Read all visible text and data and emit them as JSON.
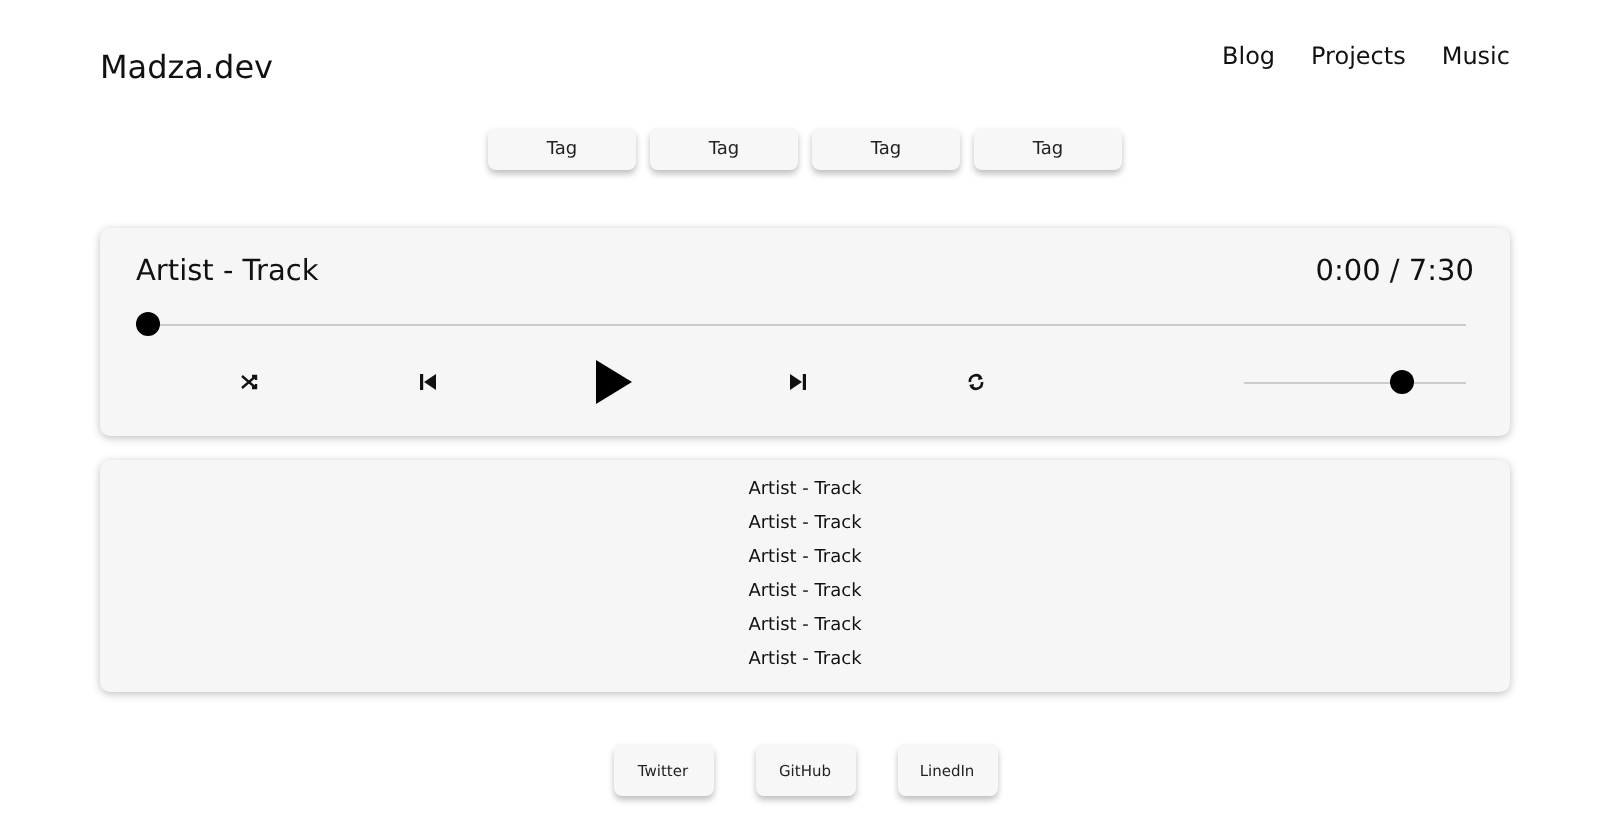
{
  "site": {
    "logo": "Madza.dev"
  },
  "nav": [
    "Blog",
    "Projects",
    "Music"
  ],
  "tags": [
    "Tag",
    "Tag",
    "Tag",
    "Tag"
  ],
  "player": {
    "title": "Artist - Track",
    "time": "0:00 / 7:30",
    "progress": {
      "level": 0
    },
    "volume": {
      "level": 0.74
    }
  },
  "playlist": [
    "Artist - Track",
    "Artist - Track",
    "Artist - Track",
    "Artist - Track",
    "Artist - Track",
    "Artist - Track"
  ],
  "footer": [
    "Twitter",
    "GitHub",
    "LinedIn"
  ]
}
